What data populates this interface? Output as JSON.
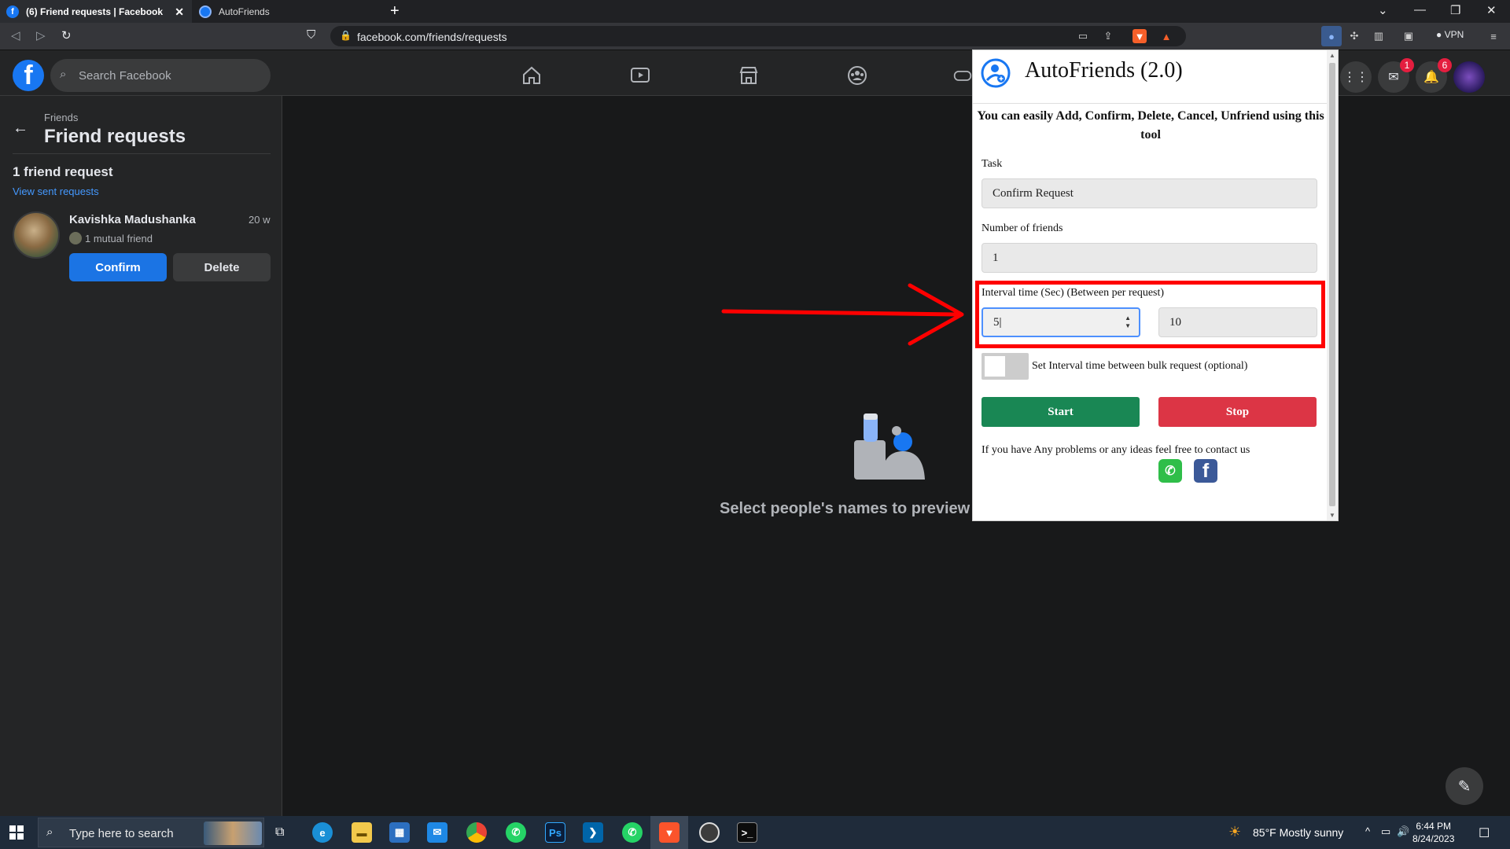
{
  "browser": {
    "tabs": [
      {
        "title": "(6) Friend requests | Facebook",
        "active": true
      },
      {
        "title": "AutoFriends",
        "active": false
      }
    ],
    "new_tab": "+",
    "url": "facebook.com/friends/requests",
    "vpn_label": "VPN"
  },
  "facebook": {
    "search_placeholder": "Search Facebook",
    "messenger_badge": "1",
    "notifications_badge": "6",
    "sidebar": {
      "breadcrumb": "Friends",
      "title": "Friend requests",
      "request_count": "1 friend request",
      "sent_link": "View sent requests",
      "requests": [
        {
          "name": "Kavishka Madushanka",
          "time": "20 w",
          "mutual": "1 mutual friend",
          "confirm_label": "Confirm",
          "delete_label": "Delete"
        }
      ]
    },
    "main_text": "Select people's names to preview t"
  },
  "extension": {
    "title": "AutoFriends (2.0)",
    "description": "You can easily Add, Confirm, Delete, Cancel, Unfriend using this tool",
    "task_label": "Task",
    "task_value": "Confirm Request",
    "friends_label": "Number of friends",
    "friends_value": "1",
    "interval_label": "Interval time (Sec) (Between per request)",
    "interval_min": "5",
    "interval_max": "10",
    "toggle_label": "Set Interval time between bulk request (optional)",
    "start_label": "Start",
    "stop_label": "Stop",
    "contact_text": "If you have Any problems or any ideas feel free to contact us"
  },
  "taskbar": {
    "search_placeholder": "Type here to search",
    "weather": "85°F  Mostly sunny",
    "time": "6:44 PM",
    "date": "8/24/2023"
  },
  "colors": {
    "facebook_blue": "#1877f2",
    "start_green": "#198754",
    "stop_red": "#dc3545",
    "annotation_red": "#ff0000"
  }
}
